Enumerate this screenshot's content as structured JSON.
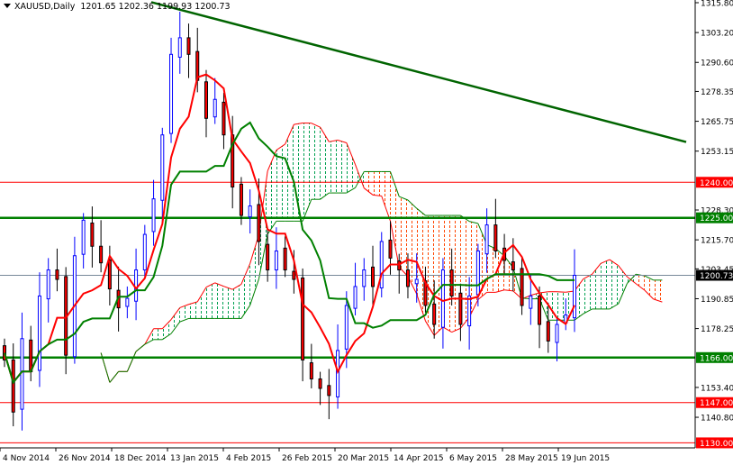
{
  "header": {
    "symbol": "XAUUSD,Daily",
    "ohlc": "1201.65 1202.36 1199.93 1200.73"
  },
  "chart_data": {
    "type": "candlestick",
    "symbol": "XAUUSD",
    "timeframe": "Daily",
    "ylim": [
      1127.5,
      1317.0
    ],
    "y_ticks": [
      "1315.80",
      "1303.20",
      "1290.60",
      "1278.35",
      "1265.75",
      "1253.15",
      "1228.30",
      "1215.70",
      "1203.45",
      "1190.85",
      "1178.25",
      "1153.40",
      "1140.80"
    ],
    "x_ticks": [
      "4 Nov 2014",
      "26 Nov 2014",
      "18 Dec 2014",
      "13 Jan 2015",
      "4 Feb 2015",
      "26 Feb 2015",
      "20 Mar 2015",
      "14 Apr 2015",
      "6 May 2015",
      "28 May 2015",
      "19 Jun 2015"
    ],
    "closes": [
      1165,
      1143,
      1174,
      1160,
      1192,
      1203,
      1199,
      1167,
      1209,
      1224,
      1213,
      1206,
      1195,
      1187,
      1191,
      1203,
      1218,
      1233,
      1260,
      1294,
      1301,
      1294,
      1283,
      1267,
      1275,
      1260,
      1238,
      1226,
      1230,
      1215,
      1203,
      1211,
      1203,
      1199,
      1165,
      1157,
      1153,
      1150,
      1169,
      1188,
      1196,
      1203,
      1196,
      1215,
      1208,
      1203,
      1196,
      1199,
      1188,
      1180,
      1203,
      1192,
      1180,
      1192,
      1211,
      1222,
      1211,
      1207,
      1203,
      1188,
      1192,
      1180,
      1173,
      1180,
      1184,
      1200.73
    ],
    "current_price": 1200.73,
    "levels": [
      {
        "price": 1240.0,
        "label": "1240.00",
        "color": "#ff0000"
      },
      {
        "price": 1225.0,
        "label": "1225.00",
        "color": "#008000"
      },
      {
        "price": 1166.0,
        "label": "1166.00",
        "color": "#008000"
      },
      {
        "price": 1147.0,
        "label": "1147.00",
        "color": "#ff0000"
      },
      {
        "price": 1130.0,
        "label": "1130.00",
        "color": "#ff0000"
      }
    ],
    "current_label": "1200.73",
    "trendline": {
      "from_price": 1316,
      "to_price": 1257,
      "color": "#006400"
    },
    "indicator": "Ichimoku",
    "colors": {
      "bull": "#0000ff",
      "bear_body": "#ff0000",
      "bear_wick": "#000000",
      "tenkan": "#ff0000",
      "kijun": "#008000",
      "cloud_up": "#00a050",
      "cloud_down": "#ff4500"
    }
  }
}
